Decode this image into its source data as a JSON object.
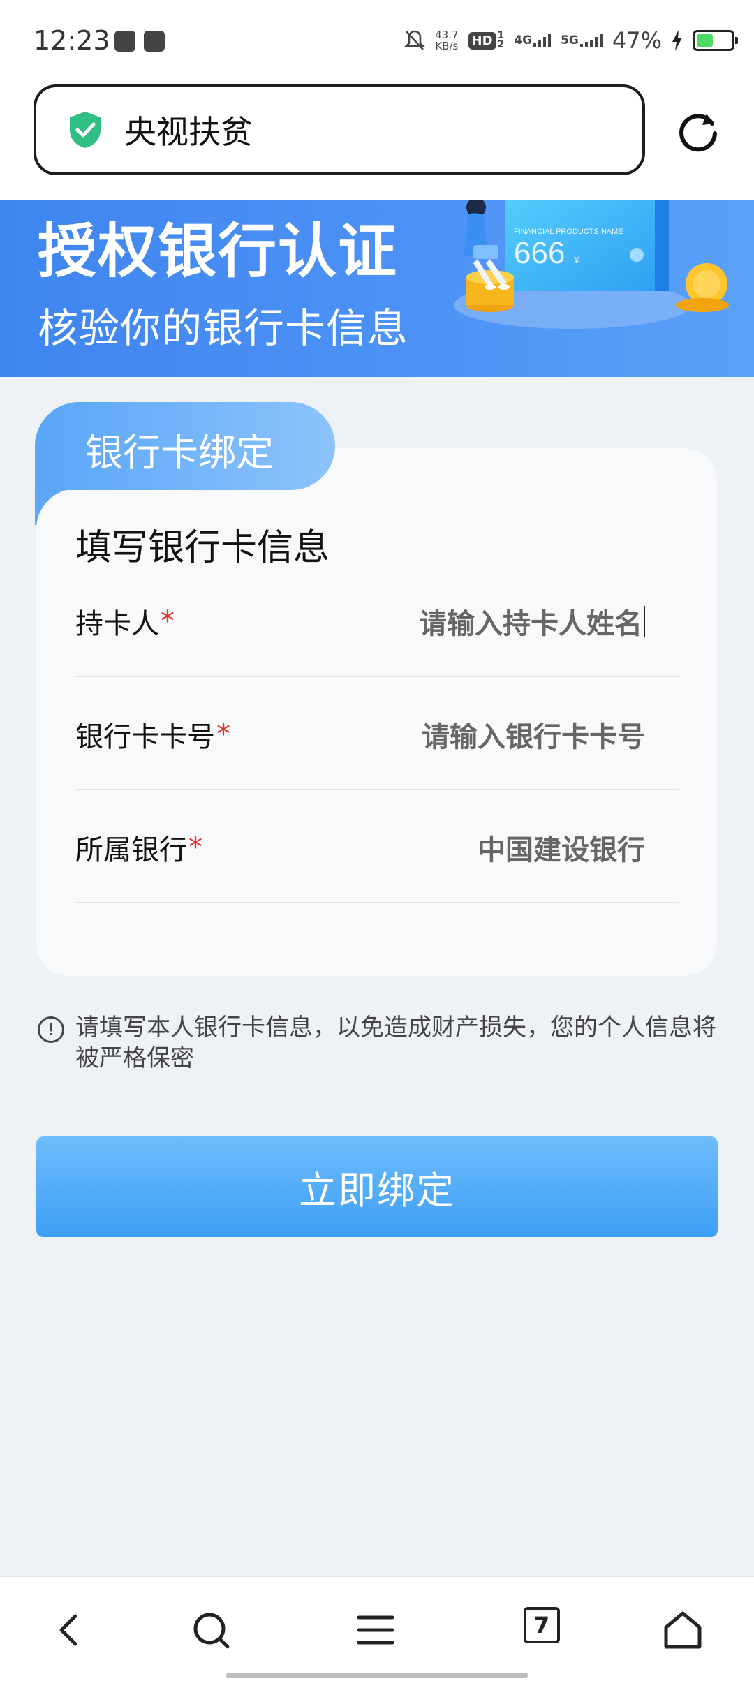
{
  "status_bar": {
    "time": "12:23",
    "net_speed_value": "43.7",
    "net_speed_unit": "KB/s",
    "hd_label": "HD",
    "hd_sub": "1",
    "hd_sub2": "2",
    "signal1": "4G",
    "signal2": "5G",
    "battery_percent": "47%",
    "battery_level": 0.47
  },
  "address_bar": {
    "title": "央视扶贫",
    "secure_icon": "shield-check-icon",
    "reload_icon": "reload-icon"
  },
  "banner": {
    "title": "授权银行认证",
    "subtitle": "核验你的银行卡信息",
    "card_label": "FINANCIAL PRODUCTS NAME",
    "card_amount": "666",
    "card_currency": "¥"
  },
  "form": {
    "tab_label": "银行卡绑定",
    "heading": "填写银行卡信息",
    "required_mark": "*",
    "fields": [
      {
        "label": "持卡人",
        "placeholder": "请输入持卡人姓名"
      },
      {
        "label": "银行卡卡号",
        "placeholder": "请输入银行卡卡号"
      },
      {
        "label": "所属银行",
        "value": "中国建设银行"
      }
    ]
  },
  "notice": {
    "icon": "!",
    "text": "请填写本人银行卡信息，以免造成财产损失，您的个人信息将被严格保密"
  },
  "submit": {
    "label": "立即绑定"
  },
  "bottom_nav": {
    "tab_count": "7"
  },
  "colors": {
    "brand_blue": "#4e93f6",
    "button_blue": "#3d9ff6",
    "required_red": "#e0302f",
    "secure_green": "#2fbf85"
  }
}
